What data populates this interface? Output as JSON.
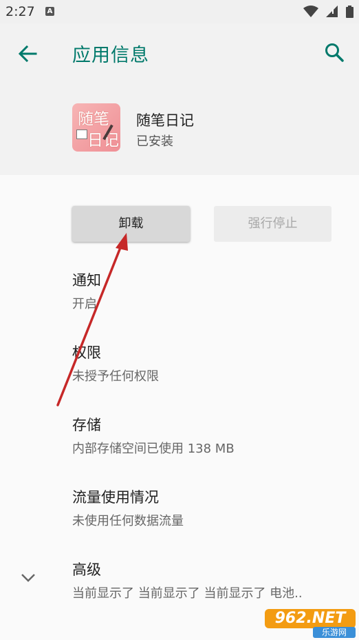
{
  "status_bar": {
    "time": "2:27",
    "notification_letter": "A"
  },
  "app_bar": {
    "title": "应用信息"
  },
  "app": {
    "icon_top_text": "随笔",
    "icon_bottom_text": "日记",
    "name": "随笔日记",
    "install_status": "已安装"
  },
  "buttons": {
    "uninstall": "卸载",
    "force_stop": "强行停止"
  },
  "items": [
    {
      "title": "通知",
      "subtitle": "开启"
    },
    {
      "title": "权限",
      "subtitle": "未授予任何权限"
    },
    {
      "title": "存储",
      "subtitle": "内部存储空间已使用 138 MB"
    },
    {
      "title": "流量使用情况",
      "subtitle": "未使用任何数据流量"
    },
    {
      "title": "高级",
      "subtitle": "当前显示了 当前显示了 当前显示了 电池.."
    }
  ],
  "watermark": {
    "main": "962.NET",
    "sub": "乐游网"
  },
  "colors": {
    "accent": "#00796b",
    "annotation_arrow": "#c62828"
  },
  "icons": {
    "back": "arrow-back-icon",
    "search": "search-icon",
    "expand": "chevron-down-icon"
  }
}
